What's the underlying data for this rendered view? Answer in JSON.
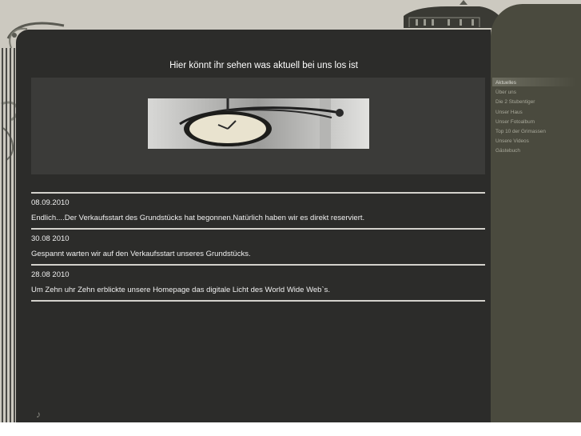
{
  "page": {
    "title": "Hier könnt ihr sehen was aktuell bei uns los ist"
  },
  "hero": {
    "image_icon": "station-clock-image"
  },
  "news": [
    {
      "date": "08.09.2010",
      "text": "Endlich....Der Verkaufsstart des Grundstücks hat begonnen.Natürlich haben wir es direkt reserviert."
    },
    {
      "date": "30.08 2010",
      "text": "Gespannt warten wir auf den Verkaufsstart unseres Grundstücks."
    },
    {
      "date": "28.08 2010",
      "text": "Um Zehn uhr Zehn erblickte unsere Homepage das digitale Licht des World Wide Web`s."
    }
  ],
  "menu": {
    "items": [
      "Aktuelles",
      "Über uns",
      "Die 2 Stubentiger",
      "Unser Haus",
      "Unser Fotoalbum",
      "Top 10 der Grimassen",
      "Unsere Videos",
      "Gästebuch"
    ],
    "active": "Aktuelles"
  },
  "colors": {
    "panel": "#2c2c2a",
    "sidebar": "#4a4a3e",
    "background": "#ccc9c0"
  }
}
